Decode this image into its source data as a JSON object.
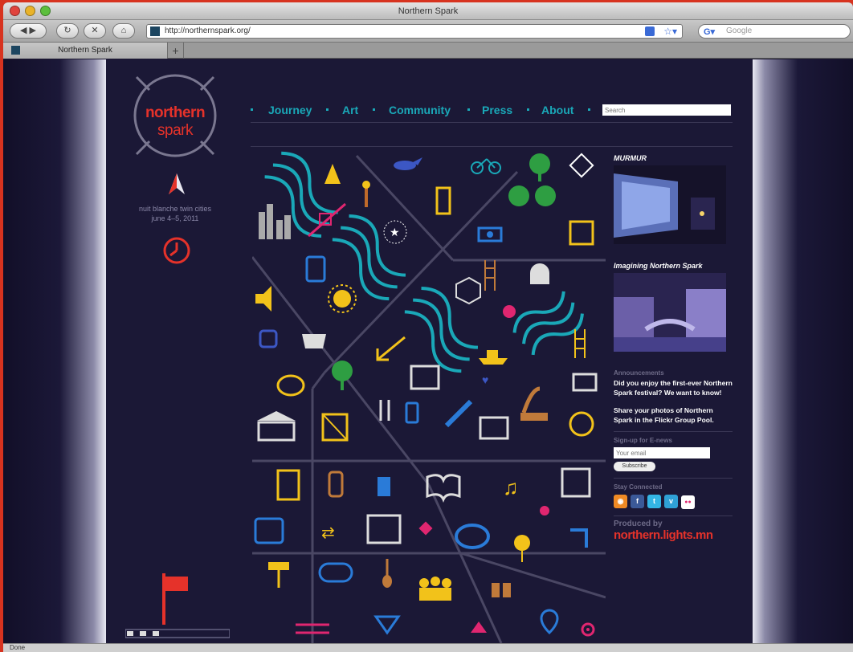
{
  "window": {
    "title": "Northern Spark"
  },
  "toolbar": {
    "url": "http://northernspark.org/",
    "search_placeholder": "Google"
  },
  "tabs": [
    {
      "label": "Northern Spark"
    }
  ],
  "status": {
    "text": "Done"
  },
  "site": {
    "logo_line1": "northern",
    "logo_line2": "spark",
    "tagline_line1": "nuit blanche twin cities",
    "tagline_line2": "june 4–5, 2011",
    "nav": [
      "Journey",
      "Art",
      "Community",
      "Press",
      "About"
    ],
    "search_placeholder": "Search",
    "sidebar": {
      "murmur_heading": "MURMUR",
      "imagining_heading": "Imagining Northern Spark",
      "announcements_heading": "Announcements",
      "announcement_1": "Did you enjoy the first-ever Northern Spark festival? We want to know!",
      "announcement_2": "Share your photos of Northern Spark in the Flickr Group Pool.",
      "signup_heading": "Sign-up for E-news",
      "email_placeholder": "Your email",
      "subscribe_label": "Subscribe",
      "stay_connected_heading": "Stay Connected",
      "social": [
        {
          "icon": "rss-icon",
          "glyph": "◉",
          "color": "#f08a24"
        },
        {
          "icon": "facebook-icon",
          "glyph": "f",
          "color": "#3b5998"
        },
        {
          "icon": "twitter-icon",
          "glyph": "t",
          "color": "#33b5e5"
        },
        {
          "icon": "vimeo-icon",
          "glyph": "v",
          "color": "#2fa1d6"
        },
        {
          "icon": "flickr-icon",
          "glyph": "●●",
          "color": "#ffffff"
        }
      ],
      "produced_by": "Produced by",
      "producer_logo": "northern.lights.mn"
    }
  },
  "colors": {
    "brand_red": "#e5322a",
    "teal": "#1aa8b8",
    "yellow": "#f2c21a",
    "page_bg": "#1b1836"
  }
}
